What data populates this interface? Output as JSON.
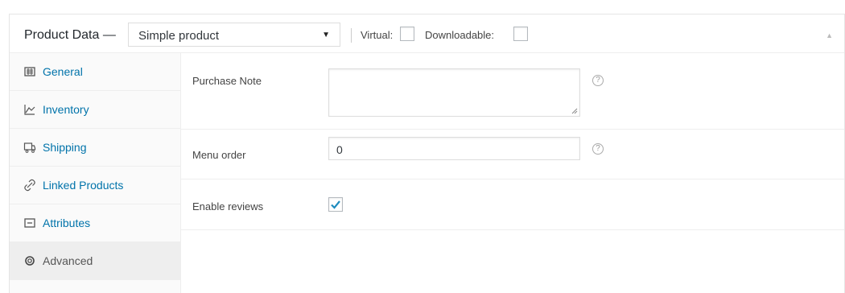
{
  "header": {
    "title": "Product Data —",
    "product_type": "Simple product",
    "virtual_label": "Virtual:",
    "virtual_checked": false,
    "downloadable_label": "Downloadable:",
    "downloadable_checked": false,
    "collapse_icon": "triangle-up-icon"
  },
  "tabs": [
    {
      "label": "General",
      "icon": "general-grid-icon",
      "active": false
    },
    {
      "label": "Inventory",
      "icon": "inventory-chart-icon",
      "active": false
    },
    {
      "label": "Shipping",
      "icon": "truck-icon",
      "active": false
    },
    {
      "label": "Linked Products",
      "icon": "link-icon",
      "active": false
    },
    {
      "label": "Attributes",
      "icon": "list-icon",
      "active": false
    },
    {
      "label": "Advanced",
      "icon": "gear-icon",
      "active": true
    }
  ],
  "fields": {
    "purchase_note": {
      "label": "Purchase Note",
      "value": ""
    },
    "menu_order": {
      "label": "Menu order",
      "value": "0"
    },
    "enable_reviews": {
      "label": "Enable reviews",
      "checked": true
    }
  },
  "help_glyph": "?",
  "colors": {
    "link": "#0073aa",
    "check": "#1e8cbe",
    "active_tab_bg": "#eeeeee"
  }
}
